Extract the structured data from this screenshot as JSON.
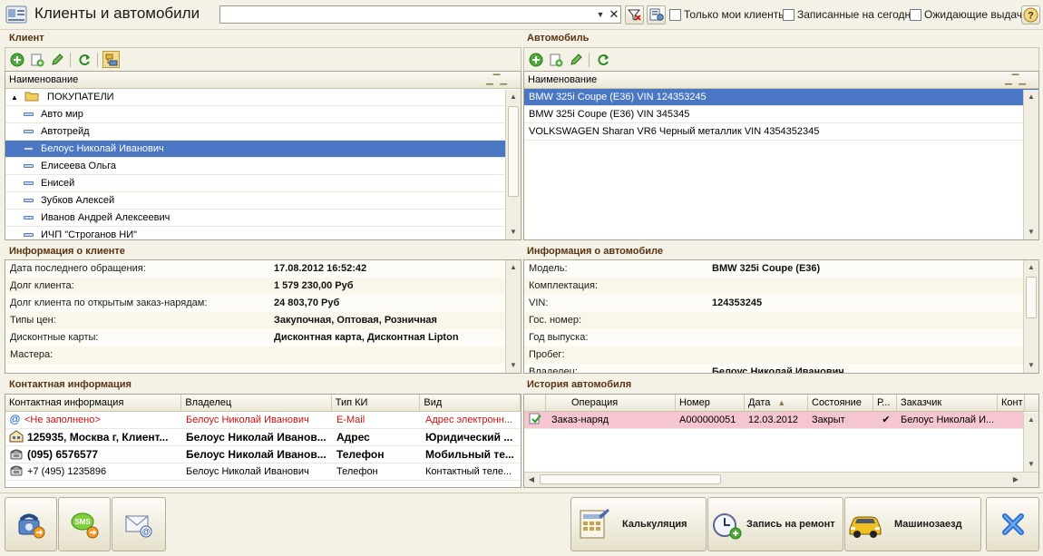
{
  "app": {
    "title": "Клиенты и автомобили"
  },
  "search": {
    "value": "",
    "placeholder": ""
  },
  "filters": {
    "only_my_clients": "Только мои клиенты",
    "recorded_today": "Записанные на сегодня",
    "awaiting_delivery": "Ожидающие выдачи"
  },
  "clients": {
    "section_title": "Клиент",
    "column": "Наименование",
    "group": "ПОКУПАТЕЛИ",
    "items": [
      "Авто мир",
      "Автотрейд",
      "Белоус Николай Иванович",
      "Елисеева Ольга",
      "Енисей",
      "Зубков Алексей",
      "Иванов Андрей Алексеевич",
      "ИЧП \"Строганов НИ\""
    ],
    "selected_index": 2
  },
  "cars": {
    "section_title": "Автомобиль",
    "column": "Наименование",
    "items": [
      "BMW 325i Coupe (E36) VIN 124353245",
      "BMW 325i Coupe (E36) VIN 345345",
      "VOLKSWAGEN Sharan VR6 Черный металлик VIN 4354352345"
    ],
    "selected_index": 0
  },
  "client_info": {
    "section_title": "Информация о клиенте",
    "rows": [
      {
        "key": "Дата последнего обращения:",
        "value": "17.08.2012 16:52:42"
      },
      {
        "key": "Долг клиента:",
        "value": "1 579 230,00 Руб"
      },
      {
        "key": "Долг клиента по открытым заказ-нарядам:",
        "value": "24 803,70 Руб"
      },
      {
        "key": "Типы цен:",
        "value": "Закупочная, Оптовая, Розничная"
      },
      {
        "key": "Дисконтные карты:",
        "value": "Дисконтная карта, Дисконтная Lipton"
      },
      {
        "key": "Мастера:",
        "value": ""
      }
    ]
  },
  "car_info": {
    "section_title": "Информация о автомобиле",
    "rows": [
      {
        "key": "Модель:",
        "value": "BMW 325i Coupe (E36)"
      },
      {
        "key": "Комплектация:",
        "value": ""
      },
      {
        "key": "VIN:",
        "value": "124353245"
      },
      {
        "key": "Гос. номер:",
        "value": ""
      },
      {
        "key": "Год выпуска:",
        "value": ""
      },
      {
        "key": "Пробег:",
        "value": ""
      },
      {
        "key": "Владелец:",
        "value": "Белоус Николай Иванович"
      }
    ]
  },
  "contacts": {
    "section_title": "Контактная информация",
    "columns": [
      "Контактная информация",
      "Владелец",
      "Тип КИ",
      "Вид"
    ],
    "rows": [
      {
        "info": "<Не заполнено>",
        "owner": "Белоус Николай Иванович",
        "type": "E-Mail",
        "kind": "Адрес электронн...",
        "icon": "email-icon",
        "style": "red"
      },
      {
        "info": "125935, Москва г, Клиент...",
        "owner": "Белоус Николай Иванов...",
        "type": "Адрес",
        "kind": "Юридический ...",
        "icon": "building-icon",
        "style": "bold"
      },
      {
        "info": "(095) 6576577",
        "owner": "Белоус Николай Иванов...",
        "type": "Телефон",
        "kind": "Мобильный те...",
        "icon": "phone-icon",
        "style": "bold"
      },
      {
        "info": "+7 (495) 1235896",
        "owner": "Белоус Николай Иванович",
        "type": "Телефон",
        "kind": "Контактный теле...",
        "icon": "phone-icon",
        "style": "normal"
      }
    ]
  },
  "history": {
    "section_title": "История автомобиля",
    "columns": [
      "Операция",
      "Номер",
      "Дата",
      "Состояние",
      "Р...",
      "Заказчик",
      "Конт"
    ],
    "rows": [
      {
        "operation": "Заказ-наряд",
        "number": "А000000051",
        "date": "12.03.2012",
        "state": "Закрыт",
        "r": "✔",
        "customer": "Белоус Николай И...",
        "contact": ""
      }
    ]
  },
  "bottom": {
    "calc": "Калькуляция",
    "repair": "Запись на ремонт",
    "arrival": "Машинозаезд"
  },
  "colors": {
    "selection": "#4a77c3",
    "section_title": "#5a3311",
    "history_row": "#f6c6d0",
    "accent_red": "#cc1111"
  }
}
